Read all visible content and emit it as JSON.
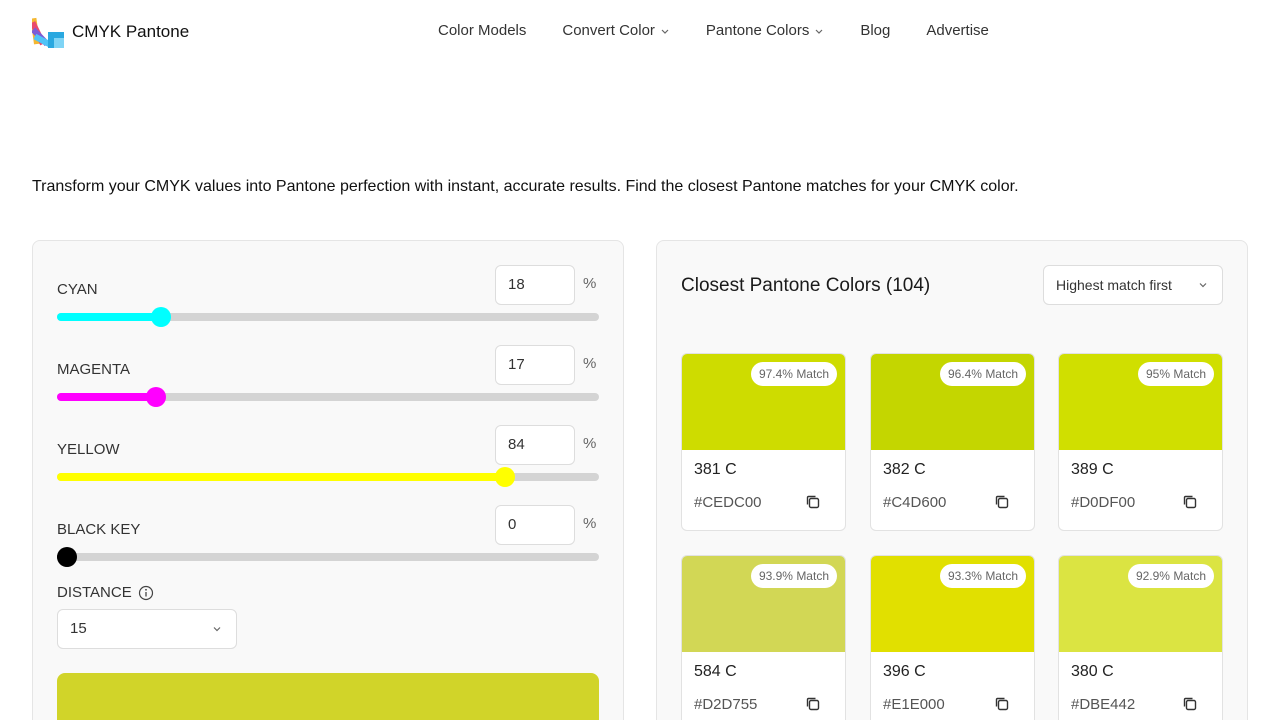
{
  "header": {
    "logo_text": "CMYK Pantone",
    "nav": [
      {
        "label": "Color Models"
      },
      {
        "label": "Convert Color",
        "dropdown": true
      },
      {
        "label": "Pantone Colors",
        "dropdown": true
      },
      {
        "label": "Blog"
      },
      {
        "label": "Advertise"
      }
    ]
  },
  "intro": "Transform your CMYK values into Pantone perfection with instant, accurate results. Find the closest Pantone matches for your CMYK color.",
  "sliders": [
    {
      "label": "CYAN",
      "value": "18",
      "unit": "%",
      "percent": 18,
      "color": "#00FFFF"
    },
    {
      "label": "MAGENTA",
      "value": "17",
      "unit": "%",
      "percent": 17,
      "color": "#FF00FF"
    },
    {
      "label": "YELLOW",
      "value": "84",
      "unit": "%",
      "percent": 84,
      "color": "#FFFF00"
    },
    {
      "label": "BLACK KEY",
      "value": "0",
      "unit": "%",
      "percent": 0,
      "color": "#000000"
    }
  ],
  "distance": {
    "label": "DISTANCE",
    "value": "15"
  },
  "preview_color": "#D1D429",
  "results": {
    "title": "Closest Pantone Colors (104)",
    "sort": "Highest match first",
    "cards": [
      {
        "name": "381 C",
        "hex": "#CEDC00",
        "match": "97.4% Match"
      },
      {
        "name": "382 C",
        "hex": "#C4D600",
        "match": "96.4% Match"
      },
      {
        "name": "389 C",
        "hex": "#D0DF00",
        "match": "95% Match"
      },
      {
        "name": "584 C",
        "hex": "#D2D755",
        "match": "93.9% Match"
      },
      {
        "name": "396 C",
        "hex": "#E1E000",
        "match": "93.3% Match"
      },
      {
        "name": "380 C",
        "hex": "#DBE442",
        "match": "92.9% Match"
      }
    ]
  }
}
